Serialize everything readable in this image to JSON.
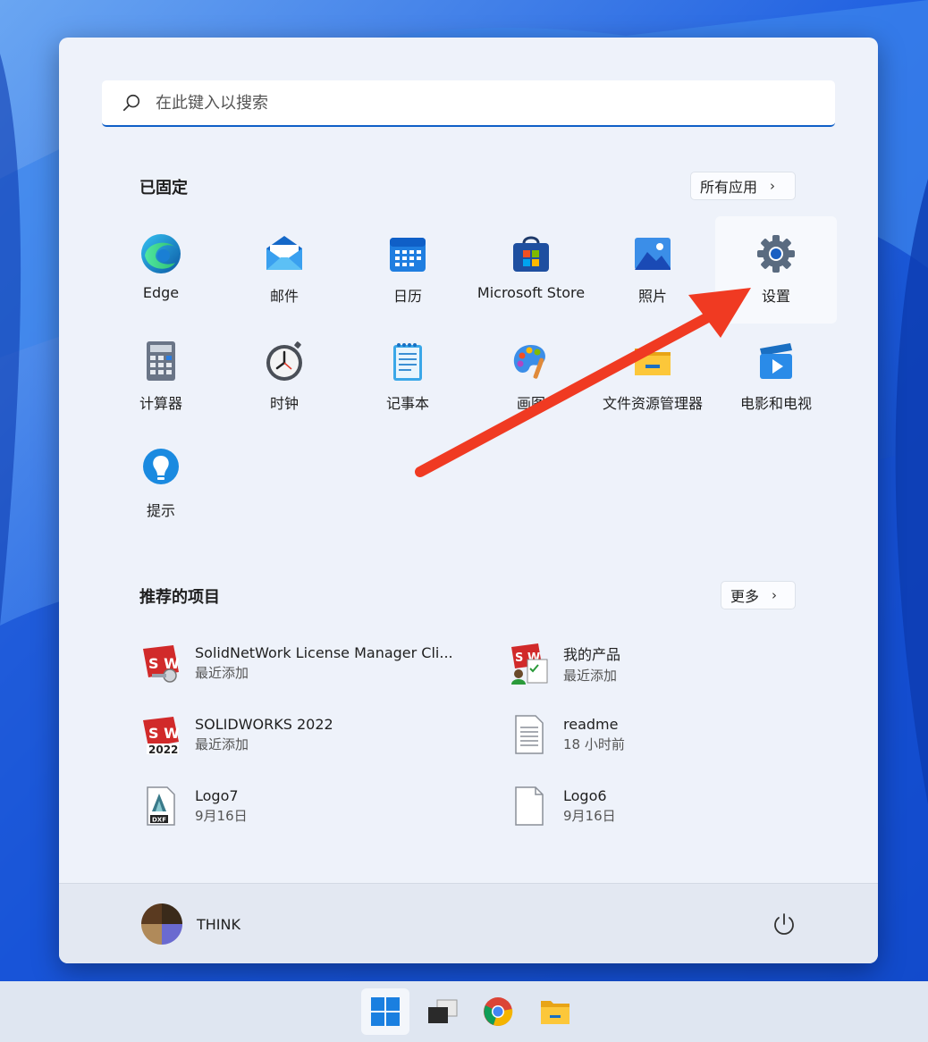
{
  "search": {
    "placeholder": "在此键入以搜索"
  },
  "pinned": {
    "title": "已固定",
    "all_apps_label": "所有应用",
    "apps": [
      {
        "label": "Edge",
        "icon": "edge-icon"
      },
      {
        "label": "邮件",
        "icon": "mail-icon"
      },
      {
        "label": "日历",
        "icon": "calendar-icon"
      },
      {
        "label": "Microsoft Store",
        "icon": "store-icon"
      },
      {
        "label": "照片",
        "icon": "photos-icon"
      },
      {
        "label": "设置",
        "icon": "gear-icon"
      },
      {
        "label": "计算器",
        "icon": "calculator-icon"
      },
      {
        "label": "时钟",
        "icon": "clock-icon"
      },
      {
        "label": "记事本",
        "icon": "notepad-icon"
      },
      {
        "label": "画图",
        "icon": "paint-icon"
      },
      {
        "label": "文件资源管理器",
        "icon": "folder-icon"
      },
      {
        "label": "电影和电视",
        "icon": "movies-icon"
      },
      {
        "label": "提示",
        "icon": "lightbulb-icon"
      }
    ]
  },
  "recommended": {
    "title": "推荐的项目",
    "more_label": "更多",
    "items": [
      {
        "name": "SolidNetWork License Manager Cli...",
        "sub": "最近添加",
        "icon": "solidworks-license-icon"
      },
      {
        "name": "我的产品",
        "sub": "最近添加",
        "icon": "solidworks-products-icon"
      },
      {
        "name": "SOLIDWORKS 2022",
        "sub": "最近添加",
        "icon": "solidworks-icon"
      },
      {
        "name": "readme",
        "sub": "18 小时前",
        "icon": "text-document-icon"
      },
      {
        "name": "Logo7",
        "sub": "9月16日",
        "icon": "dxf-file-icon"
      },
      {
        "name": "Logo6",
        "sub": "9月16日",
        "icon": "blank-document-icon"
      }
    ]
  },
  "user": {
    "name": "THINK"
  },
  "taskbar": [
    "start-icon",
    "task-view-icon",
    "chrome-icon",
    "file-explorer-icon"
  ],
  "colors": {
    "accent": "#0f5fc7",
    "arrow": "#f03a22",
    "menu_bg": "#eef2fa"
  }
}
